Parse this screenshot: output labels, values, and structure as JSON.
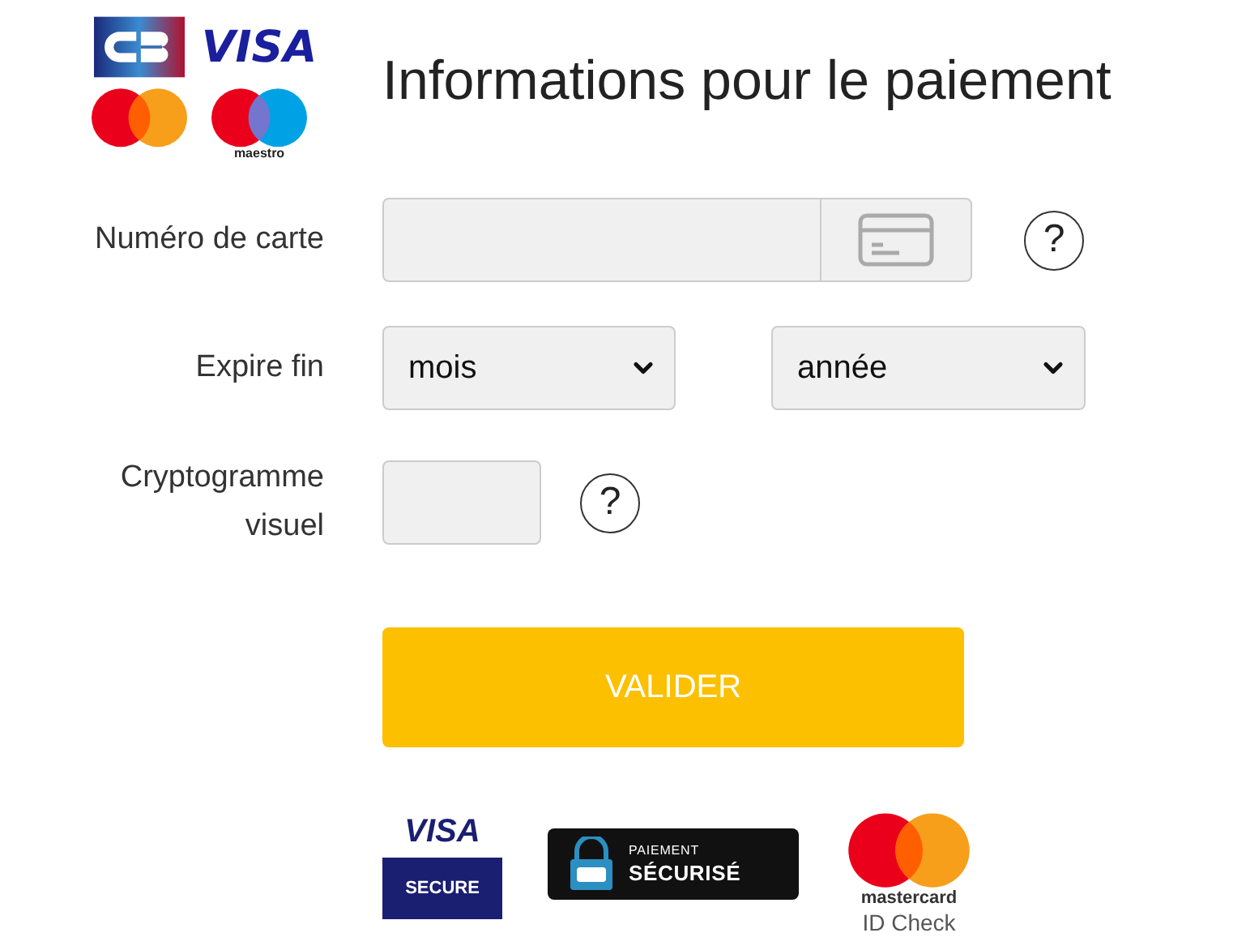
{
  "brand_logos": [
    {
      "kind": "cb"
    },
    {
      "kind": "visa",
      "text": "VISA"
    },
    {
      "kind": "mastercard"
    },
    {
      "kind": "maestro",
      "text": "maestro"
    }
  ],
  "title": "Informations pour le paiement",
  "fields": [
    {
      "kind": "card",
      "label": "Numéro de carte",
      "help": "?"
    },
    {
      "kind": "expiry",
      "label": "Expire fin",
      "selects": [
        {
          "value": "mois"
        },
        {
          "value": "année"
        }
      ]
    },
    {
      "kind": "cvv",
      "label": "Cryptogramme visuel",
      "help": "?"
    }
  ],
  "submit": "VALIDER",
  "security_badges": [
    {
      "kind": "visa_secure",
      "texts": [
        "VISA",
        "SECURE"
      ]
    },
    {
      "kind": "cb_secure",
      "texts": [
        "PAIEMENT",
        "SÉCURISÉ"
      ]
    },
    {
      "kind": "mastercard_id",
      "texts": [
        "mastercard",
        "ID Check"
      ]
    }
  ]
}
